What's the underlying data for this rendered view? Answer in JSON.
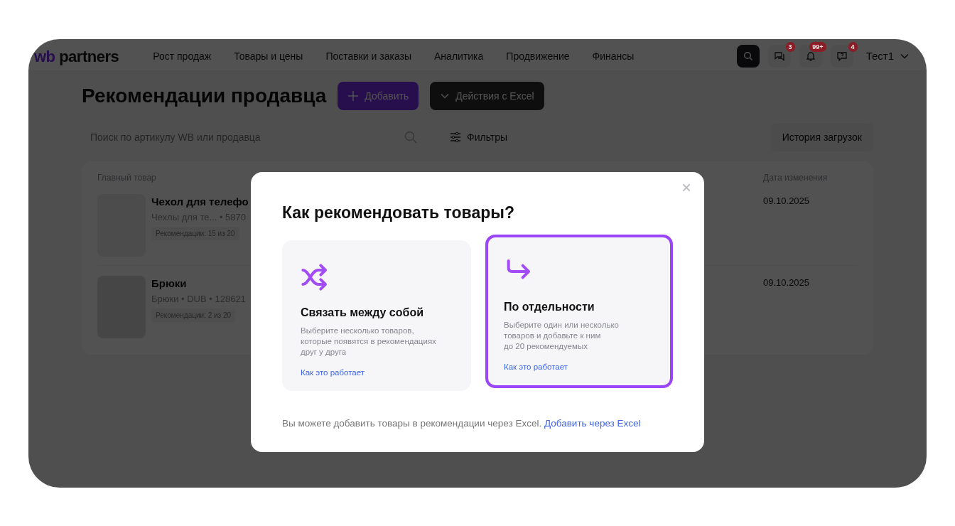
{
  "header": {
    "logo_prefix": "wb",
    "logo_text": "partners",
    "nav": [
      "Рост продаж",
      "Товары и цены",
      "Поставки и заказы",
      "Аналитика",
      "Продвижение",
      "Финансы"
    ],
    "icons": [
      {
        "kind": "chat",
        "badge": "3"
      },
      {
        "kind": "bell",
        "badge": "99+"
      },
      {
        "kind": "help",
        "badge": "4"
      }
    ],
    "user": "Тест1"
  },
  "page": {
    "title": "Рекомендации продавца",
    "add_button": "Добавить",
    "excel_button": "Действия с Excel",
    "search": {
      "placeholder": "Поиск по артикулу WB или продавца"
    },
    "filters": "Фильтры",
    "history_button": "История загрузок",
    "table": {
      "columns": [
        "Главный товар",
        "Дата изменения"
      ],
      "rows": [
        {
          "name": "Чехол для телефо",
          "meta": "Чехлы для те... • 5870",
          "recs": "Рекомендации: 15 из 20",
          "date": "09.10.2025"
        },
        {
          "name": "Брюки",
          "meta": "Брюки • DUB • 128621",
          "recs": "Рекомендации: 2 из 20",
          "date": "09.10.2025"
        }
      ]
    }
  },
  "modal": {
    "title": "Как рекомендовать товары?",
    "close": "×",
    "options": [
      {
        "kind": "shuffle",
        "title": "Связать между собой",
        "text": "Выберите несколько товаров,\nкоторые появятся в рекомендациях\nдруг у друга",
        "link": "Как это работает",
        "selected": false
      },
      {
        "kind": "single",
        "title": "По отдельности",
        "text": "Выберите один или несколько\nтоваров и добавьте к ним\nдо 20 рекомендуемых",
        "link": "Как это работает",
        "selected": true
      }
    ],
    "footer_text": "Вы можете добавить товары в рекомендации через Excel.",
    "footer_link": "Добавить через Excel"
  }
}
